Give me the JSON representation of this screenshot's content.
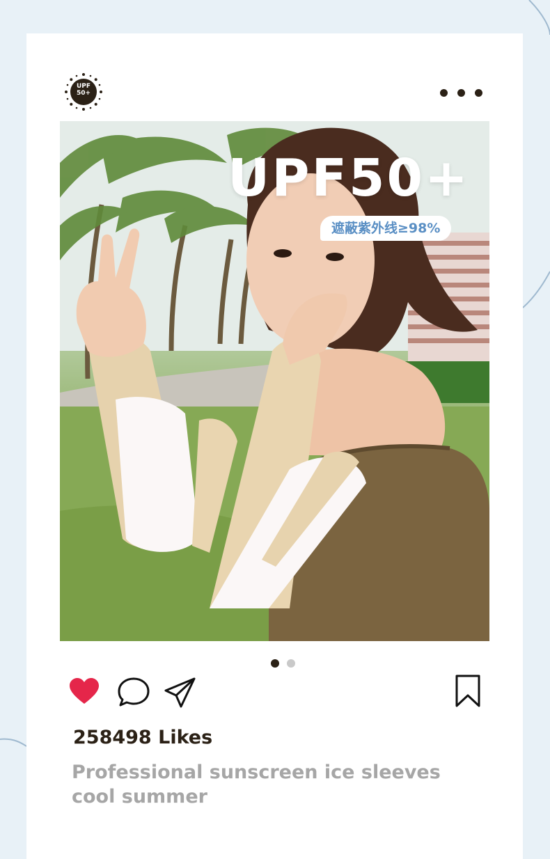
{
  "post": {
    "avatar_badge_line1": "UPF",
    "avatar_badge_line2": "50+",
    "menu_icon": "more-horizontal-icon",
    "image": {
      "headline": "UPF50+",
      "badge": "遮蔽紫外线≥98%",
      "description": "Woman in off-shoulder olive top and beige/white arm sleeves making a peace sign by palm trees"
    },
    "carousel": {
      "total": 2,
      "active_index": 0
    },
    "actions": {
      "like_icon": "heart-icon",
      "comment_icon": "comment-icon",
      "share_icon": "send-icon",
      "save_icon": "bookmark-icon"
    },
    "likes": "258498 Likes",
    "caption": "Professional sunscreen ice sleeves cool summer"
  },
  "colors": {
    "background": "#e8f1f7",
    "card": "#ffffff",
    "heart": "#e5264a",
    "text_dark": "#2b2116",
    "caption_gray": "#a6a6a6",
    "badge_text": "#5a8fc4"
  }
}
